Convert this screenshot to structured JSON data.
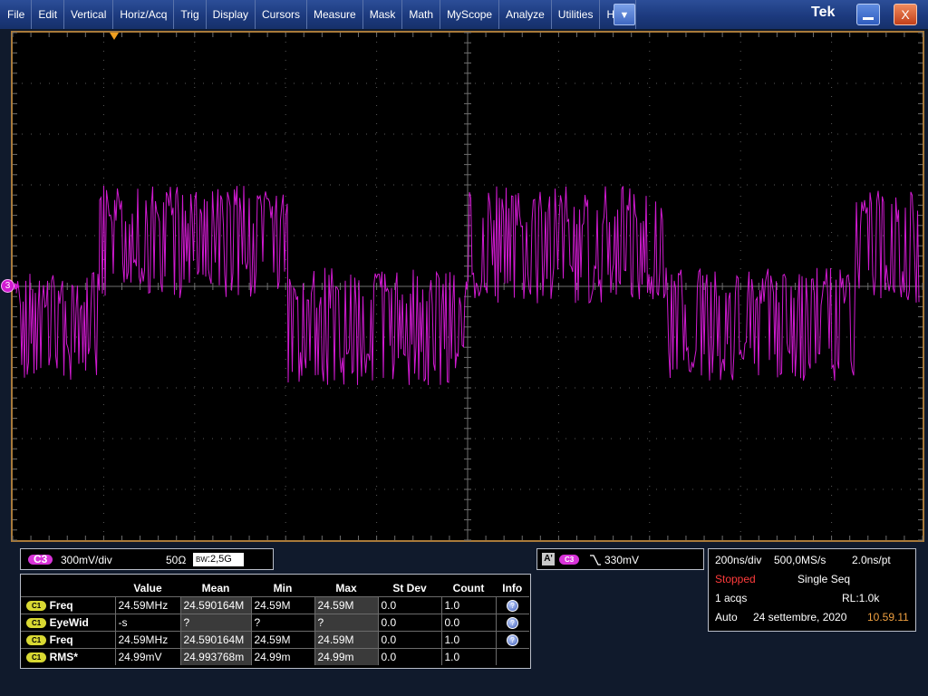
{
  "menubar": {
    "items": [
      "File",
      "Edit",
      "Vertical",
      "Horiz/Acq",
      "Trig",
      "Display",
      "Cursors",
      "Measure",
      "Mask",
      "Math",
      "MyScope",
      "Analyze",
      "Utilities",
      "Help"
    ],
    "dropdown_icon": "▼",
    "logo": "Tek",
    "minimize_label": "—",
    "close_label": "X"
  },
  "display": {
    "channel_marker": "3",
    "trace_color": "#d11ad1",
    "frame_color": "#a87a3a",
    "trigger_marker_color": "#f0a020"
  },
  "vertical": {
    "channel": "C3",
    "scale": "300mV/div",
    "termination": "50Ω",
    "bandwidth_prefix": "BW",
    "bandwidth": ":2,5G"
  },
  "trigger": {
    "source_label": "A'",
    "channel": "C3",
    "slope_icon": "falling-edge",
    "level": "330mV"
  },
  "measurements": {
    "headers": [
      "Value",
      "Mean",
      "Min",
      "Max",
      "St Dev",
      "Count",
      "Info"
    ],
    "rows": [
      {
        "channel": "C1",
        "name": "Freq",
        "value": "24.59MHz",
        "mean": "24.590164M",
        "min": "24.59M",
        "max": "24.59M",
        "stdev": "0.0",
        "count": "1.0",
        "info": true
      },
      {
        "channel": "C1",
        "name": "EyeWid",
        "value": "-s",
        "mean": "?",
        "min": "?",
        "max": "?",
        "stdev": "0.0",
        "count": "0.0",
        "info": true
      },
      {
        "channel": "C1",
        "name": "Freq",
        "value": "24.59MHz",
        "mean": "24.590164M",
        "min": "24.59M",
        "max": "24.59M",
        "stdev": "0.0",
        "count": "1.0",
        "info": true
      },
      {
        "channel": "C1",
        "name": "RMS*",
        "value": "24.99mV",
        "mean": "24.993768m",
        "min": "24.99m",
        "max": "24.99m",
        "stdev": "0.0",
        "count": "1.0",
        "info": false
      }
    ]
  },
  "acquisition": {
    "time_div": "200ns/div",
    "sample_rate": "500,0MS/s",
    "resolution": "2.0ns/pt",
    "state": "Stopped",
    "mode": "Single Seq",
    "acqs": "1 acqs",
    "record_length": "RL:1.0k",
    "trigger_mode": "Auto",
    "date": "24 settembre, 2020",
    "time": "10.59.11",
    "stopped_color": "#ff3b3b",
    "time_color": "#f0a040"
  }
}
